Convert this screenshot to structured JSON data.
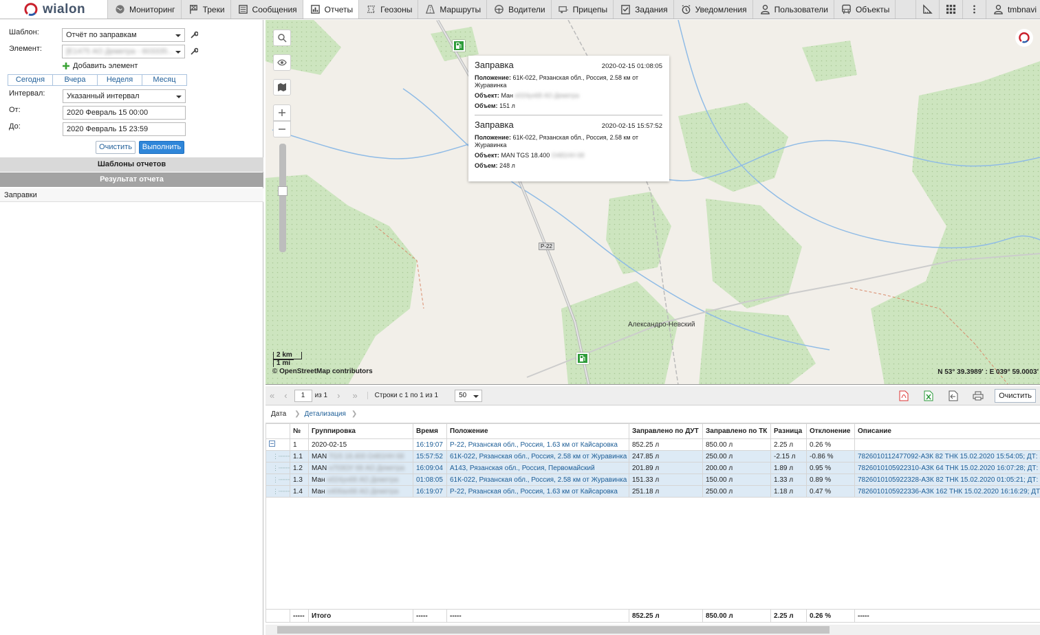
{
  "app": {
    "logo_text": "wialon",
    "user": "tmbnavi"
  },
  "nav": [
    {
      "label": "Мониторинг",
      "icon": "globe-icon"
    },
    {
      "label": "Треки",
      "icon": "flag-icon"
    },
    {
      "label": "Сообщения",
      "icon": "list-icon"
    },
    {
      "label": "Отчеты",
      "icon": "report-icon"
    },
    {
      "label": "Геозоны",
      "icon": "geofence-icon"
    },
    {
      "label": "Маршруты",
      "icon": "route-icon"
    },
    {
      "label": "Водители",
      "icon": "steering-wheel-icon"
    },
    {
      "label": "Прицепы",
      "icon": "trailer-icon"
    },
    {
      "label": "Задания",
      "icon": "task-icon"
    },
    {
      "label": "Уведомления",
      "icon": "clock-icon"
    },
    {
      "label": "Пользователи",
      "icon": "user-icon"
    },
    {
      "label": "Объекты",
      "icon": "bus-icon"
    }
  ],
  "active_nav": "Отчеты",
  "form": {
    "template_label": "Шаблон:",
    "template_value": "Отчёт по заправкам",
    "element_label": "Элемент:",
    "element_value": "[E1475 АО Деметра - 603335...",
    "add_element": "Добавить элемент",
    "periods": [
      "Сегодня",
      "Вчера",
      "Неделя",
      "Месяц"
    ],
    "interval_label": "Интервал:",
    "interval_value": "Указанный интервал",
    "from_label": "От:",
    "from_value": "2020 Февраль 15 00:00",
    "to_label": "До:",
    "to_value": "2020 Февраль 15 23:59",
    "clear_btn": "Очистить",
    "run_btn": "Выполнить"
  },
  "panels": {
    "templates": "Шаблоны отчетов",
    "result": "Результат отчета",
    "result_item": "Заправки"
  },
  "popup": {
    "entries": [
      {
        "title": "Заправка",
        "time": "2020-02-15 01:08:05",
        "pos_label": "Положение:",
        "pos": "61К-022, Рязанская обл., Россия, 2.58 км от Журавинка",
        "obj_label": "Объект:",
        "obj": "Ман",
        "obj_blur": "н024ун68 АО Деметра",
        "vol_label": "Объем:",
        "vol": "151 л"
      },
      {
        "title": "Заправка",
        "time": "2020-02-15 15:57:52",
        "pos_label": "Положение:",
        "pos": "61К-022, Рязанская обл., Россия, 2.58 км от Журавинка",
        "obj_label": "Объект:",
        "obj": "MAN TGS 18.400",
        "obj_blur": "О481НН 68",
        "vol_label": "Объем:",
        "vol": "248 л"
      }
    ]
  },
  "map": {
    "town": "Александро-Невский",
    "road": "Р-22",
    "scale_km": "2 km",
    "scale_mi": "1 mi",
    "attribution": "© OpenStreetMap contributors",
    "coords": "N 53° 39.3989' : E 039° 59.0003'"
  },
  "toolbar": {
    "page": "1",
    "of": "из 1",
    "rows": "Строки с 1 по 1 из 1",
    "per_page": "50",
    "clear": "Очистить"
  },
  "tabs": [
    "Дата",
    "Детализация"
  ],
  "table": {
    "headers": [
      "№",
      "Группировка",
      "Время",
      "Положение",
      "Заправлено по ДУТ",
      "Заправлено по ТК",
      "Разница",
      "Отклонение",
      "Описание"
    ],
    "group": {
      "num": "1",
      "group": "2020-02-15",
      "time": "16:19:07",
      "pos": "Р-22, Рязанская обл., Россия, 1.63 км от Кайсаровка",
      "dut": "852.25 л",
      "tk": "850.00 л",
      "diff": "2.25 л",
      "dev": "0.26 %",
      "desc": ""
    },
    "rows": [
      {
        "num": "1.1",
        "group": "MAN",
        "group_blur": "TGS 18.400 О481НН 68",
        "time": "15:57:52",
        "pos": "61К-022, Рязанская обл., Россия, 2.58 км от Журавинка",
        "dut": "247.85 л",
        "tk": "250.00 л",
        "diff": "-2.15 л",
        "dev": "-0.86 %",
        "desc": "7826010112477092-АЗК 82 ТНК 15.02.2020 15:54:05; ДТ: 2"
      },
      {
        "num": "1.2",
        "group": "MAN",
        "group_blur": "н703ОУ 68 АО Деметра",
        "time": "16:09:04",
        "pos": "А143, Рязанская обл., Россия, Первомайский",
        "dut": "201.89 л",
        "tk": "200.00 л",
        "diff": "1.89 л",
        "dev": "0.95 %",
        "desc": "7826010105922310-АЗК 64 ТНК 15.02.2020 16:07:28; ДТ:"
      },
      {
        "num": "1.3",
        "group": "Ман",
        "group_blur": "н024ун68 АО Деметра",
        "time": "01:08:05",
        "pos": "61К-022, Рязанская обл., Россия, 2.58 км от Журавинка",
        "dut": "151.33 л",
        "tk": "150.00 л",
        "diff": "1.33 л",
        "dev": "0.89 %",
        "desc": "7826010105922328-АЗК 82 ТНК 15.02.2020 01:05:21; ДТ:"
      },
      {
        "num": "1.4",
        "group": "Ман",
        "group_blur": "о406ах68 АО Деметра",
        "time": "16:19:07",
        "pos": "Р-22, Рязанская обл., Россия, 1.63 км от Кайсаровка",
        "dut": "251.18 л",
        "tk": "250.00 л",
        "diff": "1.18 л",
        "dev": "0.47 %",
        "desc": "7826010105922336-АЗК 162 ТНК 15.02.2020 16:16:29; ДТ"
      }
    ],
    "footer": {
      "num": "-----",
      "group": "Итого",
      "time": "-----",
      "pos": "-----",
      "dut": "852.25 л",
      "tk": "850.00 л",
      "diff": "2.25 л",
      "dev": "0.26 %",
      "desc": "-----"
    }
  },
  "colors": {
    "accent": "#2f86d9",
    "link": "#1c5d96",
    "forest": "#cfe6c0",
    "water": "#9cc3e8",
    "road": "#bcbcbc"
  }
}
